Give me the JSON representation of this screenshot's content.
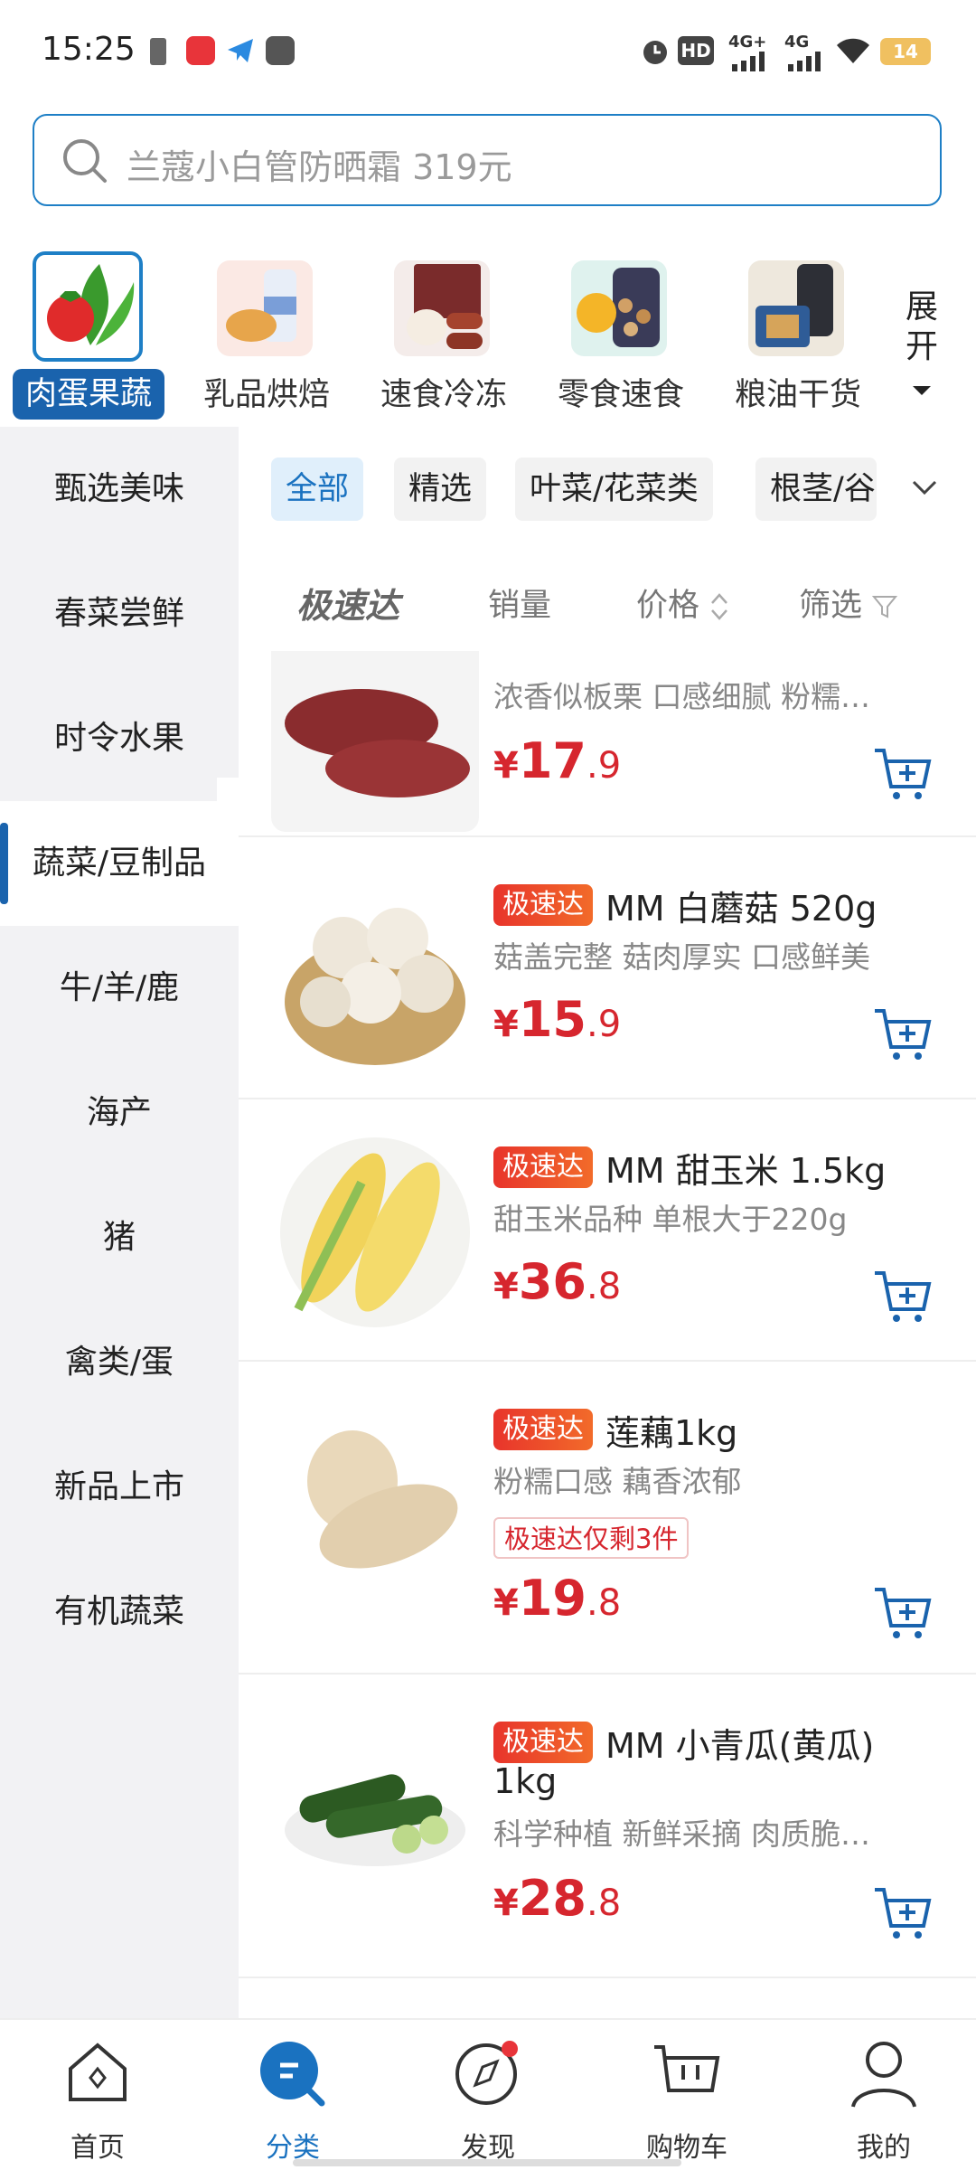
{
  "status_bar": {
    "time": "15:25",
    "battery": "14",
    "network1": "4G+",
    "network2": "4G",
    "hd": "HD"
  },
  "search": {
    "placeholder": "兰蔻小白管防晒霜 319元"
  },
  "categories": [
    {
      "label": "肉蛋果蔬",
      "icon": "vegetables-icon"
    },
    {
      "label": "乳品烘焙",
      "icon": "dairy-icon"
    },
    {
      "label": "速食冷冻",
      "icon": "frozen-food-icon"
    },
    {
      "label": "零食速食",
      "icon": "snacks-icon"
    },
    {
      "label": "粮油干货",
      "icon": "grain-oil-icon"
    }
  ],
  "expand_label_1": "展",
  "expand_label_2": "开",
  "left_nav": [
    "甄选美味",
    "春菜尝鲜",
    "时令水果",
    "蔬菜/豆制品",
    "牛/羊/鹿",
    "海产",
    "猪",
    "禽类/蛋",
    "新品上市",
    "有机蔬菜"
  ],
  "chips": [
    "全部",
    "精选",
    "叶菜/花菜类",
    "根茎/谷"
  ],
  "sort": {
    "fast": "极速达",
    "sales": "销量",
    "price": "价格",
    "filter": "筛选"
  },
  "products": [
    {
      "desc": "浓香似板栗 口感细腻 粉糯…",
      "price_int": "17",
      "price_dec": ".9"
    },
    {
      "tag": "极速达",
      "title": "MM 白蘑菇 520g",
      "desc": "菇盖完整 菇肉厚实 口感鲜美",
      "price_int": "15",
      "price_dec": ".9"
    },
    {
      "tag": "极速达",
      "title": "MM 甜玉米 1.5kg",
      "desc": "甜玉米品种 单根大于220g",
      "price_int": "36",
      "price_dec": ".8"
    },
    {
      "tag": "极速达",
      "title": "莲藕1kg",
      "desc": "粉糯口感 藕香浓郁",
      "stock": "极速达仅剩3件",
      "price_int": "19",
      "price_dec": ".8"
    },
    {
      "tag": "极速达",
      "title": "MM 小青瓜(黄瓜)",
      "title2": "1kg",
      "desc": "科学种植 新鲜采摘 肉质脆…",
      "price_int": "28",
      "price_dec": ".8"
    }
  ],
  "currency": "¥",
  "bottom_nav": [
    {
      "label": "首页",
      "icon": "home-icon"
    },
    {
      "label": "分类",
      "icon": "category-search-icon"
    },
    {
      "label": "发现",
      "icon": "compass-icon"
    },
    {
      "label": "购物车",
      "icon": "cart-icon"
    },
    {
      "label": "我的",
      "icon": "profile-icon"
    }
  ],
  "colors": {
    "accent": "#1a63ad",
    "price": "#d6262e",
    "tag_start": "#e8342b",
    "tag_end": "#f26b2a"
  }
}
